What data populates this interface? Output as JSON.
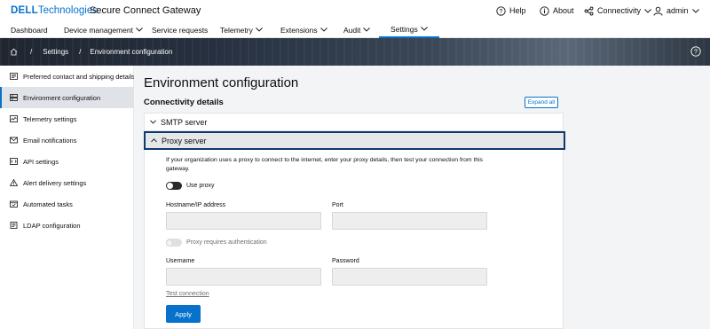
{
  "brand": {
    "logo_dell": "DELL",
    "logo_tech": "Technologies",
    "product": "Secure Connect Gateway",
    "accent": "#0672cb"
  },
  "topnav": {
    "help": "Help",
    "about": "About",
    "connectivity": "Connectivity",
    "user": "admin"
  },
  "mainnav": {
    "items": [
      "Dashboard",
      "Device management",
      "Service requests",
      "Telemetry",
      "Extensions",
      "Audit",
      "Settings"
    ],
    "active": "Settings"
  },
  "breadcrumb": {
    "home_icon": "home-icon",
    "sep": "/",
    "level1": "Settings",
    "level2": "Environment configuration"
  },
  "sidebar": {
    "items": [
      {
        "label": "Preferred contact and shipping details",
        "icon": "contact-card-icon"
      },
      {
        "label": "Environment configuration",
        "icon": "server-icon",
        "active": true
      },
      {
        "label": "Telemetry settings",
        "icon": "telemetry-icon"
      },
      {
        "label": "Email notifications",
        "icon": "envelope-icon"
      },
      {
        "label": "API settings",
        "icon": "api-icon"
      },
      {
        "label": "Alert delivery settings",
        "icon": "warning-icon"
      },
      {
        "label": "Automated tasks",
        "icon": "calendar-check-icon"
      },
      {
        "label": "LDAP configuration",
        "icon": "document-icon"
      }
    ]
  },
  "main": {
    "title": "Environment configuration",
    "section": "Connectivity details",
    "expand_all": "Expand all",
    "smtp": {
      "label": "SMTP server",
      "expanded": false
    },
    "proxy": {
      "label": "Proxy server",
      "expanded": true,
      "description": "If your organization uses a proxy to connect to the internet, enter your proxy details, then test your connection from this gateway.",
      "use_proxy": {
        "label": "Use proxy",
        "on": false
      },
      "hostname": {
        "label": "Hostname/IP address",
        "value": ""
      },
      "port": {
        "label": "Port",
        "value": ""
      },
      "auth": {
        "label": "Proxy requires authentication",
        "disabled": true
      },
      "username": {
        "label": "Username",
        "value": ""
      },
      "password": {
        "label": "Password",
        "value": ""
      },
      "test_connection": "Test connection",
      "apply": "Apply"
    }
  }
}
